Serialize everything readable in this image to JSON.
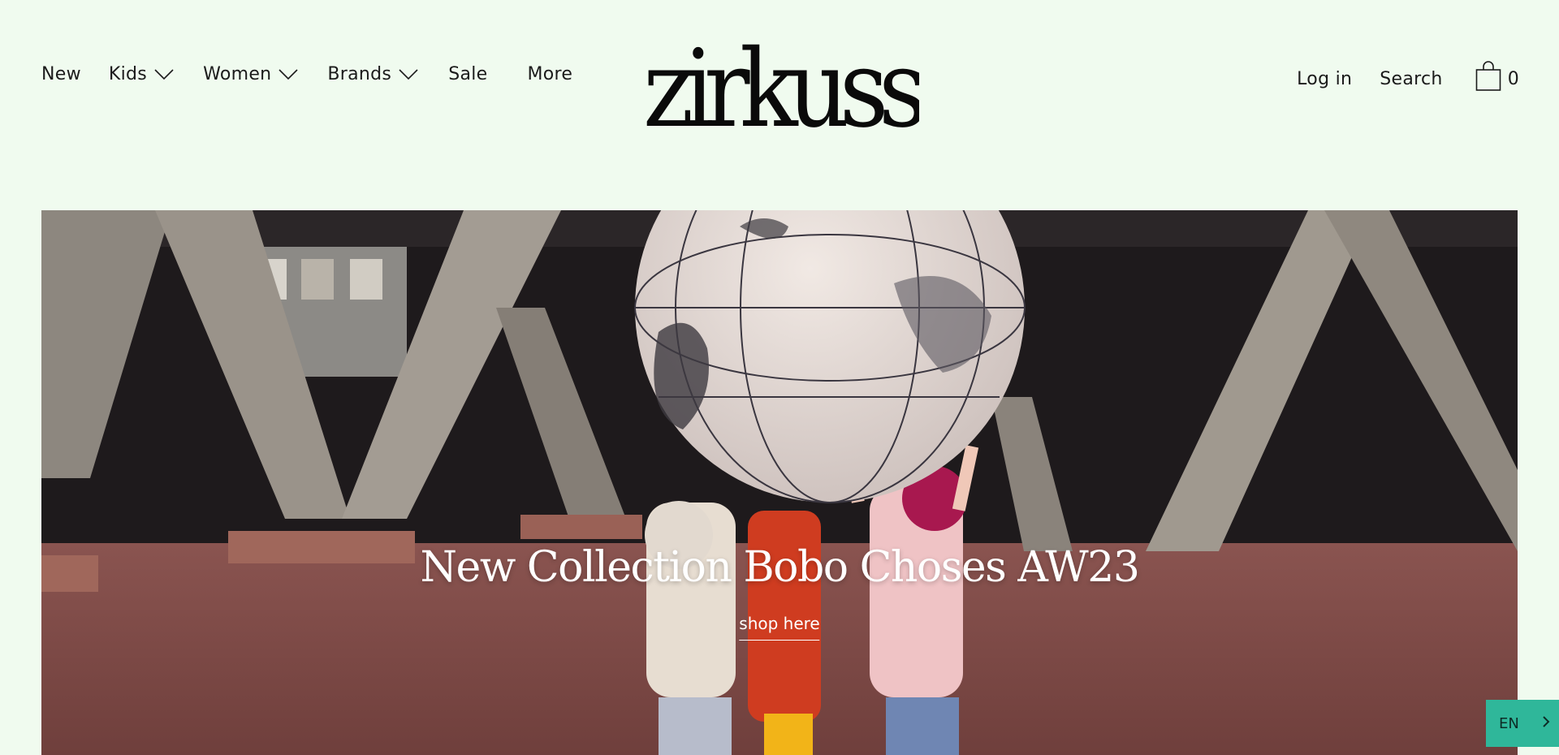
{
  "nav": {
    "items": [
      {
        "label": "New"
      },
      {
        "label": "Kids"
      },
      {
        "label": "Women"
      },
      {
        "label": "Brands"
      },
      {
        "label": "Sale"
      },
      {
        "label": "More"
      }
    ]
  },
  "logo": {
    "text": "zirkuss"
  },
  "account": {
    "login_label": "Log in",
    "search_label": "Search",
    "cart_count": "0"
  },
  "hero": {
    "title": "New Collection Bobo Choses AW23",
    "cta_label": "shop here"
  },
  "language": {
    "code": "EN"
  },
  "colors": {
    "page_background": "#f0fbef",
    "language_widget": "#2fb79a",
    "text": "#1b1b1b"
  },
  "icons": [
    "chevron-down-icon",
    "shopping-bag-icon",
    "chevron-right-icon"
  ]
}
